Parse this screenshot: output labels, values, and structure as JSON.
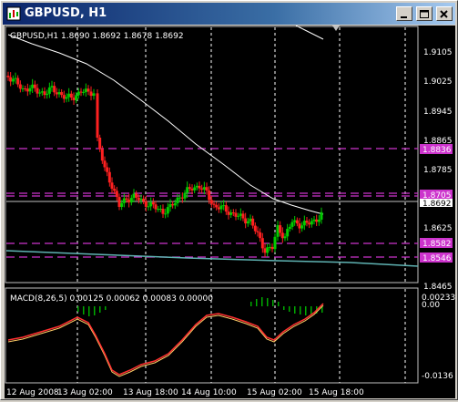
{
  "window": {
    "title": "GBPUSD, H1",
    "icon": "chart-window-icon",
    "buttons": [
      "minimize-icon",
      "restore-icon",
      "close-icon"
    ]
  },
  "main_chart": {
    "info_label": "GBPUSD,H1  1.8690 1.8692 1.8678 1.8692",
    "price_axis_labels": [
      "1.9105",
      "1.9025",
      "1.8945",
      "1.8865",
      "1.8785",
      "1.8625",
      "1.8465"
    ],
    "price_tags": [
      {
        "label": "1.8836",
        "color": "#cc33cc"
      },
      {
        "label": "1.8705",
        "color": "#cc33cc"
      },
      {
        "label": "1.8692",
        "color": "#ffffff"
      },
      {
        "label": "1.8582",
        "color": "#cc33cc"
      },
      {
        "label": "1.8546",
        "color": "#cc33cc"
      }
    ]
  },
  "macd_panel": {
    "label": "MACD(8,26,5) 0.00125 0.00062 0.00083 0.00000",
    "axis_labels": [
      "0.00233",
      "0.00",
      "-0.0136"
    ]
  },
  "time_axis_labels": [
    "12 Aug 2008",
    "13 Aug 02:00",
    "13 Aug 18:00",
    "14 Aug 10:00",
    "15 Aug 02:00",
    "15 Aug 18:00"
  ],
  "colors": {
    "background": "#000000",
    "bull_candle": "#00cc00",
    "bear_candle": "#ff2020",
    "moving_average": "#ffffff",
    "level_line": "#cc33cc",
    "lower_line": "#5fb3b3",
    "macd_line": "#ff3030",
    "signal_line": "#ffcc66",
    "histogram": "#00aa00"
  }
}
